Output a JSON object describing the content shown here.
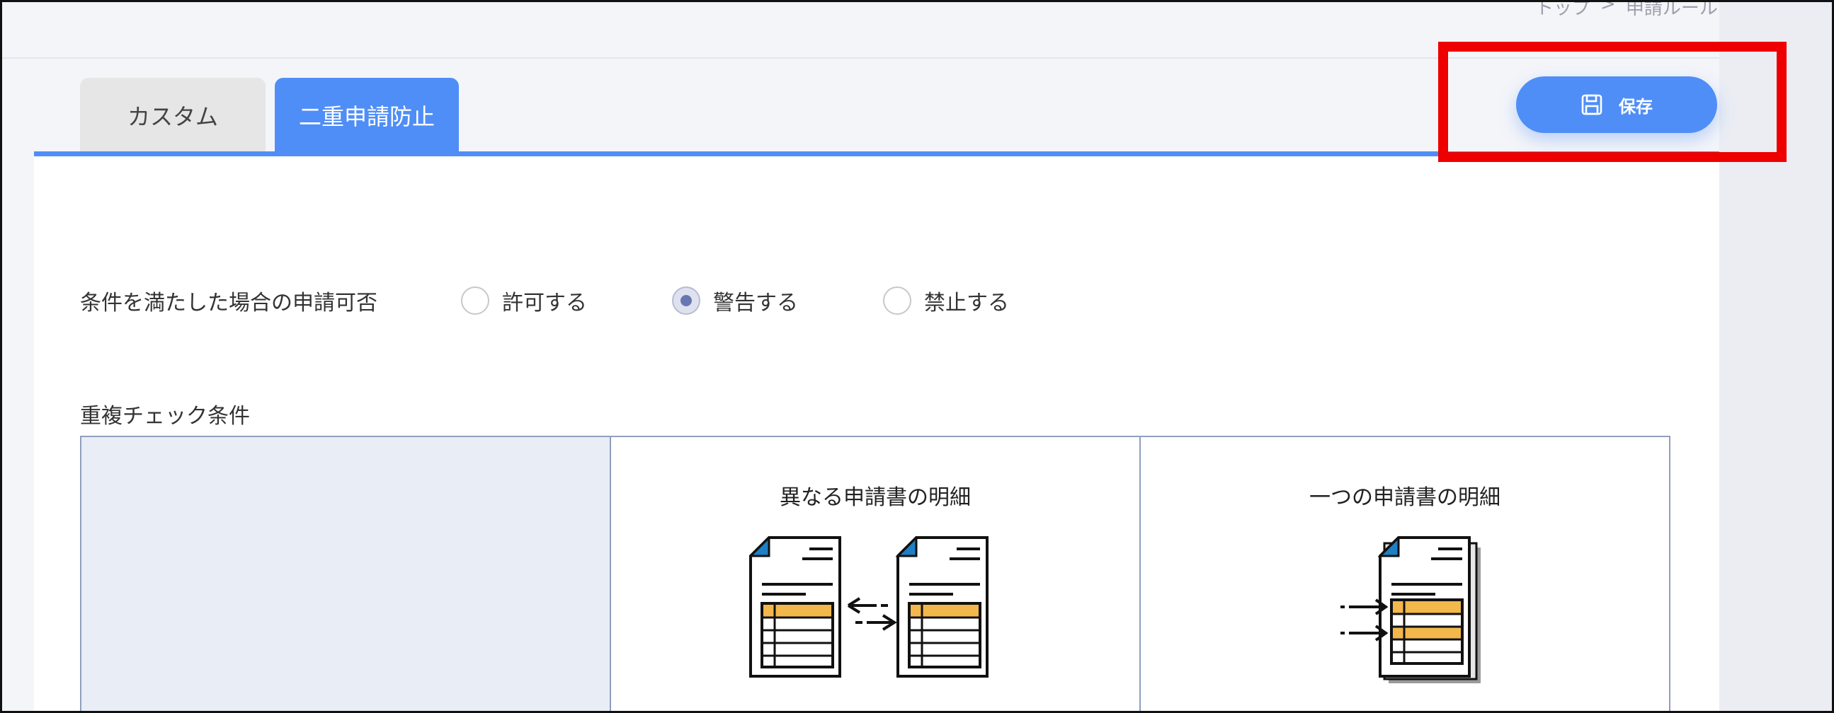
{
  "breadcrumb": {
    "home": "トップ",
    "sep": ">",
    "current": "申請ルール"
  },
  "tabs": [
    {
      "label": "カスタム",
      "active": false
    },
    {
      "label": "二重申請防止",
      "active": true
    }
  ],
  "toolbar": {
    "save_label": "保存",
    "save_icon": "floppy-disk-icon"
  },
  "condition": {
    "label": "条件を満たした場合の申請可否",
    "options": [
      {
        "label": "許可する",
        "selected": false
      },
      {
        "label": "警告する",
        "selected": true
      },
      {
        "label": "禁止する",
        "selected": false
      }
    ]
  },
  "duplicate_check": {
    "title": "重複チェック条件",
    "columns": [
      {
        "label": "",
        "icon": ""
      },
      {
        "label": "異なる申請書の明細",
        "icon": "two-documents-compare-icon"
      },
      {
        "label": "一つの申請書の明細",
        "icon": "stacked-documents-icon"
      }
    ]
  },
  "colors": {
    "accent": "#4f8ef7",
    "highlight": "#ee0000",
    "radio_selected": "#6877b3",
    "doc_accent": "#1f7fc4",
    "row_highlight": "#f2b84b"
  }
}
